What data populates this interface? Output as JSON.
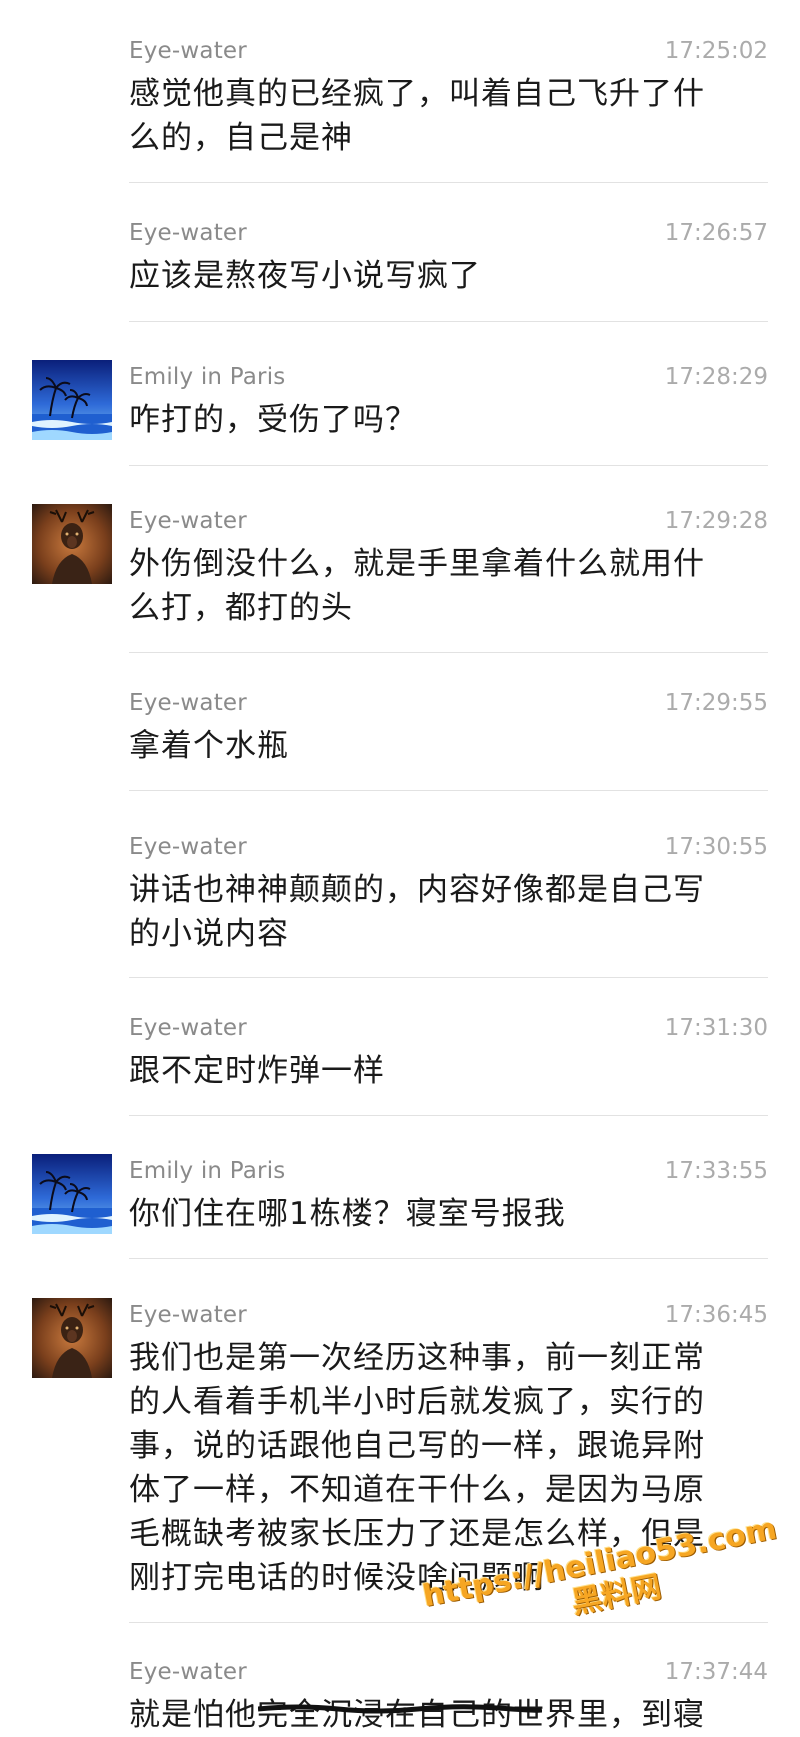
{
  "messages": [
    {
      "sender": "Eye-water",
      "time": "17:25:02",
      "avatar": "",
      "lines": [
        "感觉他真的已经疯了，叫着自己飞升了什",
        "么的，自己是神"
      ]
    },
    {
      "sender": "Eye-water",
      "time": "17:26:57",
      "avatar": "",
      "lines": [
        "应该是熬夜写小说写疯了"
      ]
    },
    {
      "sender": "Emily in Paris",
      "time": "17:28:29",
      "avatar": "beach-palm-avatar",
      "lines": [
        "咋打的，受伤了吗？"
      ]
    },
    {
      "sender": "Eye-water",
      "time": "17:29:28",
      "avatar": "deer-avatar",
      "lines": [
        "外伤倒没什么，就是手里拿着什么就用什",
        "么打，都打的头"
      ]
    },
    {
      "sender": "Eye-water",
      "time": "17:29:55",
      "avatar": "",
      "lines": [
        "拿着个水瓶"
      ]
    },
    {
      "sender": "Eye-water",
      "time": "17:30:55",
      "avatar": "",
      "lines": [
        "讲话也神神颠颠的，内容好像都是自己写",
        "的小说内容"
      ]
    },
    {
      "sender": "Eye-water",
      "time": "17:31:30",
      "avatar": "",
      "lines": [
        "跟不定时炸弹一样"
      ]
    },
    {
      "sender": "Emily in Paris",
      "time": "17:33:55",
      "avatar": "beach-palm-avatar",
      "lines": [
        "你们住在哪1栋楼？寝室号报我"
      ]
    },
    {
      "sender": "Eye-water",
      "time": "17:36:45",
      "avatar": "deer-avatar",
      "lines": [
        "我们也是第一次经历这种事，前一刻正常",
        "的人看着手机半小时后就发疯了，实行的",
        "事，说的话跟他自己写的一样，跟诡异附",
        "体了一样，不知道在干什么，是因为马原",
        "毛概缺考被家长压力了还是怎么样，但是",
        "刚打完电话的时候没啥问题啊"
      ]
    },
    {
      "sender": "Eye-water",
      "time": "17:37:44",
      "avatar": "",
      "lines": [
        "就是怕他完全沉浸在自己的世界里，到寝"
      ]
    }
  ],
  "watermark": {
    "url": "https://heiliao53.com",
    "name": "黑料网"
  },
  "colors": {
    "sender": "#8a8a8a",
    "time": "#ababab",
    "body": "#1a1a1a",
    "divider": "#e2e2e2",
    "watermark": "#f6a623"
  }
}
